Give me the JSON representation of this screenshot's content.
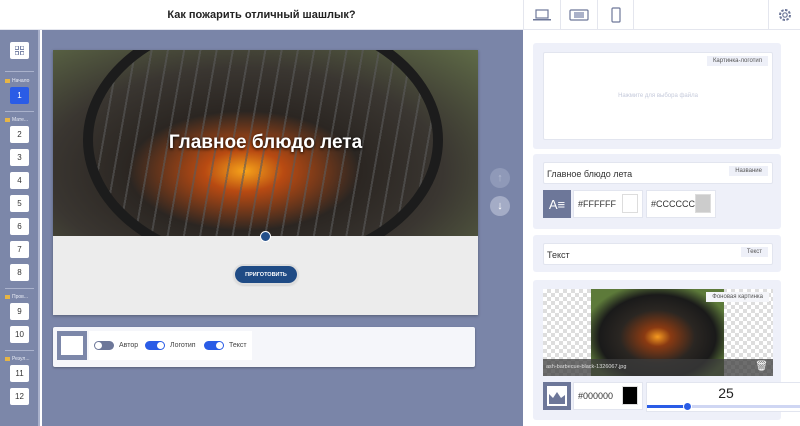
{
  "header": {
    "title": "Как пожарить отличный шашлык?",
    "devices": [
      "laptop-icon",
      "tablet-icon",
      "phone-icon"
    ]
  },
  "sidebar": {
    "sections": [
      {
        "label": "Начало",
        "slides": [
          "1"
        ]
      },
      {
        "label": "Мате...",
        "slides": [
          "2",
          "3",
          "4",
          "5",
          "6",
          "7",
          "8"
        ]
      },
      {
        "label": "Пров...",
        "slides": [
          "9",
          "10"
        ]
      },
      {
        "label": "Резул...",
        "slides": [
          "11",
          "12"
        ]
      }
    ],
    "active_slide": "1"
  },
  "preview": {
    "heading": "Главное блюдо лета",
    "button_label": "ПРИГОТОВИТЬ"
  },
  "toolbar": {
    "toggles": [
      {
        "label": "Автор",
        "on": false
      },
      {
        "label": "Логотип",
        "on": true
      },
      {
        "label": "Текст",
        "on": true
      }
    ]
  },
  "panel": {
    "logo": {
      "tag": "Картинка-логотип",
      "placeholder": "Нажмите для выбора файла"
    },
    "title": {
      "value": "Главное блюдо лета",
      "tag": "Название",
      "text_color": "#FFFFFF",
      "shadow_color": "#CCCCCC"
    },
    "text": {
      "value": "Текст",
      "tag": "Текст"
    },
    "background": {
      "tag": "Фоновая картинка",
      "filename": "ash-barbecue-black-1326067.jpg",
      "overlay_color": "#000000",
      "opacity": "25"
    }
  },
  "colors": {
    "accent": "#2a5ce6",
    "sidebar": "#7c87a9",
    "cta": "#1f4b85"
  }
}
